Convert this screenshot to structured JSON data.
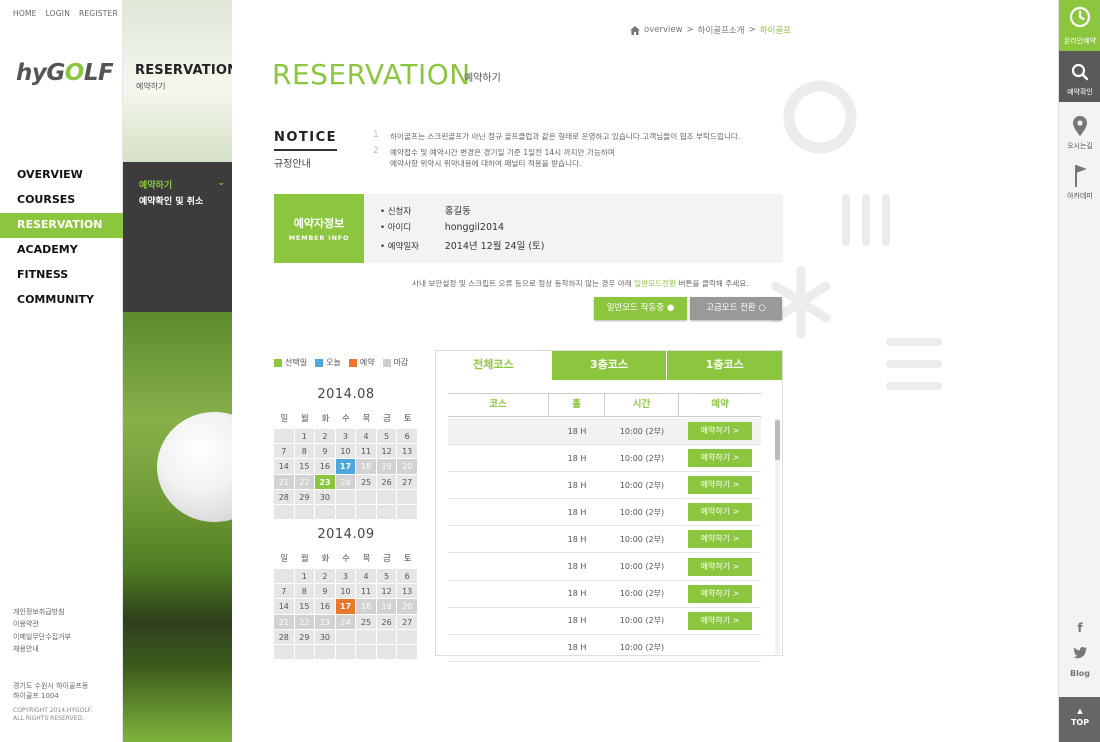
{
  "top_nav": [
    "HOME",
    "LOGIN",
    "REGISTER"
  ],
  "logo": {
    "text_pre": "hyG",
    "text_o": "O",
    "text_post": "LF"
  },
  "main_menu": [
    "OVERVIEW",
    "COURSES",
    "RESERVATION",
    "ACADEMY",
    "FITNESS",
    "COMMUNITY"
  ],
  "footer": {
    "links": [
      "개인정보취급방침",
      "이용약관",
      "이메일무단수집거부",
      "채용안내"
    ],
    "address": [
      "경기도 수원시 하이골프동",
      "하이골프 1004"
    ],
    "copyright": [
      "COPYRIGHT 2014.HYGOLF.",
      "ALL RIGHTS RESERVED."
    ]
  },
  "sub": {
    "title": "RESERVATION",
    "title_ko": "예약하기",
    "menu": [
      "예약하기",
      "예약확인 및 취소"
    ]
  },
  "breadcrumb": [
    "overview",
    ">",
    "하이골프소개",
    ">",
    "하이골프"
  ],
  "page": {
    "title": "RESERVATION",
    "title_ko": "예약하기"
  },
  "notice": {
    "title": "NOTICE",
    "title_ko": "규정안내",
    "items": [
      {
        "num": "1",
        "lines": [
          "하이골프는 스크린골프가 아닌 정규 골프클럽과 같은 형태로 운영하고 있습니다.고객님들이 협조 부탁드립니다."
        ]
      },
      {
        "num": "2",
        "lines": [
          "예약접수 및 예약시간 변경은 경기일 기준 1일전 14시 까지만 가능하며",
          "예약사항 위약시 위약내용에 대하여 패널티 적용을 받습니다."
        ]
      }
    ]
  },
  "member": {
    "label_ko": "예약자정보",
    "label_en": "MEMBER INFO",
    "rows": [
      {
        "label": "• 신청자",
        "value": "홍길동"
      },
      {
        "label": "• 아이디",
        "value": "honggil2014"
      },
      {
        "label": "• 예약일자",
        "value": "2014년 12월 24일 (토)"
      }
    ]
  },
  "mode": {
    "note_pre": "사내 보안설정 및 스크립트 오류 등으로 정상 동작하지 않는 경우 아래 ",
    "note_hl": "일반모드전환",
    "note_post": " 버튼을 클릭해 주세요.",
    "normal_label": "일반모드 작동중 ●",
    "advanced_label": "고급모드 전환 ○"
  },
  "legend": [
    {
      "label": "선택일",
      "color": "#8cc63f"
    },
    {
      "label": "오늘",
      "color": "#4fa6d9"
    },
    {
      "label": "예약",
      "color": "#e9772a"
    },
    {
      "label": "마감",
      "color": "#cccccc"
    }
  ],
  "weekdays": [
    "일",
    "월",
    "화",
    "수",
    "목",
    "금",
    "토"
  ],
  "calendars": [
    {
      "title": "2014.08",
      "cells": [
        {
          "d": "",
          "s": "blank"
        },
        {
          "d": "1",
          "s": ""
        },
        {
          "d": "2",
          "s": ""
        },
        {
          "d": "3",
          "s": ""
        },
        {
          "d": "4",
          "s": ""
        },
        {
          "d": "5",
          "s": ""
        },
        {
          "d": "6",
          "s": ""
        },
        {
          "d": "7",
          "s": ""
        },
        {
          "d": "8",
          "s": ""
        },
        {
          "d": "9",
          "s": ""
        },
        {
          "d": "10",
          "s": ""
        },
        {
          "d": "11",
          "s": ""
        },
        {
          "d": "12",
          "s": ""
        },
        {
          "d": "13",
          "s": ""
        },
        {
          "d": "14",
          "s": ""
        },
        {
          "d": "15",
          "s": ""
        },
        {
          "d": "16",
          "s": ""
        },
        {
          "d": "17",
          "s": "today"
        },
        {
          "d": "18",
          "s": "closed"
        },
        {
          "d": "19",
          "s": "closed"
        },
        {
          "d": "20",
          "s": "closed"
        },
        {
          "d": "21",
          "s": "closed"
        },
        {
          "d": "22",
          "s": "closed"
        },
        {
          "d": "23",
          "s": "selected"
        },
        {
          "d": "24",
          "s": "closed"
        },
        {
          "d": "25",
          "s": ""
        },
        {
          "d": "26",
          "s": ""
        },
        {
          "d": "27",
          "s": ""
        },
        {
          "d": "28",
          "s": ""
        },
        {
          "d": "29",
          "s": ""
        },
        {
          "d": "30",
          "s": ""
        },
        {
          "d": "",
          "s": "blank"
        },
        {
          "d": "",
          "s": "blank"
        },
        {
          "d": "",
          "s": "blank"
        },
        {
          "d": "",
          "s": "blank"
        },
        {
          "d": "",
          "s": "blank"
        },
        {
          "d": "",
          "s": "blank"
        },
        {
          "d": "",
          "s": "blank"
        },
        {
          "d": "",
          "s": "blank"
        },
        {
          "d": "",
          "s": "blank"
        },
        {
          "d": "",
          "s": "blank"
        },
        {
          "d": "",
          "s": "blank"
        }
      ]
    },
    {
      "title": "2014.09",
      "cells": [
        {
          "d": "",
          "s": "blank"
        },
        {
          "d": "1",
          "s": ""
        },
        {
          "d": "2",
          "s": ""
        },
        {
          "d": "3",
          "s": ""
        },
        {
          "d": "4",
          "s": ""
        },
        {
          "d": "5",
          "s": ""
        },
        {
          "d": "6",
          "s": ""
        },
        {
          "d": "7",
          "s": ""
        },
        {
          "d": "8",
          "s": ""
        },
        {
          "d": "9",
          "s": ""
        },
        {
          "d": "10",
          "s": ""
        },
        {
          "d": "11",
          "s": ""
        },
        {
          "d": "12",
          "s": ""
        },
        {
          "d": "13",
          "s": ""
        },
        {
          "d": "14",
          "s": ""
        },
        {
          "d": "15",
          "s": ""
        },
        {
          "d": "16",
          "s": ""
        },
        {
          "d": "17",
          "s": "reserved"
        },
        {
          "d": "18",
          "s": "closed"
        },
        {
          "d": "19",
          "s": "closed"
        },
        {
          "d": "20",
          "s": "closed"
        },
        {
          "d": "21",
          "s": "closed"
        },
        {
          "d": "22",
          "s": "closed"
        },
        {
          "d": "23",
          "s": "closed"
        },
        {
          "d": "24",
          "s": "closed"
        },
        {
          "d": "25",
          "s": ""
        },
        {
          "d": "26",
          "s": ""
        },
        {
          "d": "27",
          "s": ""
        },
        {
          "d": "28",
          "s": ""
        },
        {
          "d": "29",
          "s": ""
        },
        {
          "d": "30",
          "s": ""
        },
        {
          "d": "",
          "s": "blank"
        },
        {
          "d": "",
          "s": "blank"
        },
        {
          "d": "",
          "s": "blank"
        },
        {
          "d": "",
          "s": "blank"
        },
        {
          "d": "",
          "s": "blank"
        },
        {
          "d": "",
          "s": "blank"
        },
        {
          "d": "",
          "s": "blank"
        },
        {
          "d": "",
          "s": "blank"
        },
        {
          "d": "",
          "s": "blank"
        },
        {
          "d": "",
          "s": "blank"
        },
        {
          "d": "",
          "s": "blank"
        }
      ]
    }
  ],
  "course_tabs": [
    {
      "label": "전체코스",
      "active": true
    },
    {
      "label": "3층코스",
      "active": false
    },
    {
      "label": "1층코스",
      "active": false
    }
  ],
  "table_headers": [
    "코스",
    "홀",
    "시간",
    "예약"
  ],
  "slots": [
    {
      "course": "",
      "hole": "18 H",
      "time": "10:00 (2부)",
      "button": "예약하기 >"
    },
    {
      "course": "",
      "hole": "18 H",
      "time": "10:00 (2부)",
      "button": "예약하기 >"
    },
    {
      "course": "",
      "hole": "18 H",
      "time": "10:00 (2부)",
      "button": "예약하기 >"
    },
    {
      "course": "",
      "hole": "18 H",
      "time": "10:00 (2부)",
      "button": "예약하기 >"
    },
    {
      "course": "",
      "hole": "18 H",
      "time": "10:00 (2부)",
      "button": "예약하기 >"
    },
    {
      "course": "",
      "hole": "18 H",
      "time": "10:00 (2부)",
      "button": "예약하기 >"
    },
    {
      "course": "",
      "hole": "18 H",
      "time": "10:00 (2부)",
      "button": "예약하기 >"
    },
    {
      "course": "",
      "hole": "18 H",
      "time": "10:00 (2부)",
      "button": "예약하기 >"
    },
    {
      "course": "",
      "hole": "18 H",
      "time": "10:00 (2부)",
      "button": ""
    }
  ],
  "right_bar": {
    "online": "온라인예약",
    "check": "예약확인",
    "directions": "오시는길",
    "academy": "아카데미",
    "facebook": "f",
    "blog": "Blog",
    "top": "TOP"
  },
  "colors": {
    "accent": "#8cc63f",
    "today": "#4fa6d9",
    "reserved": "#e9772a",
    "closed": "#cccccc",
    "dark": "#3c3c3c"
  }
}
